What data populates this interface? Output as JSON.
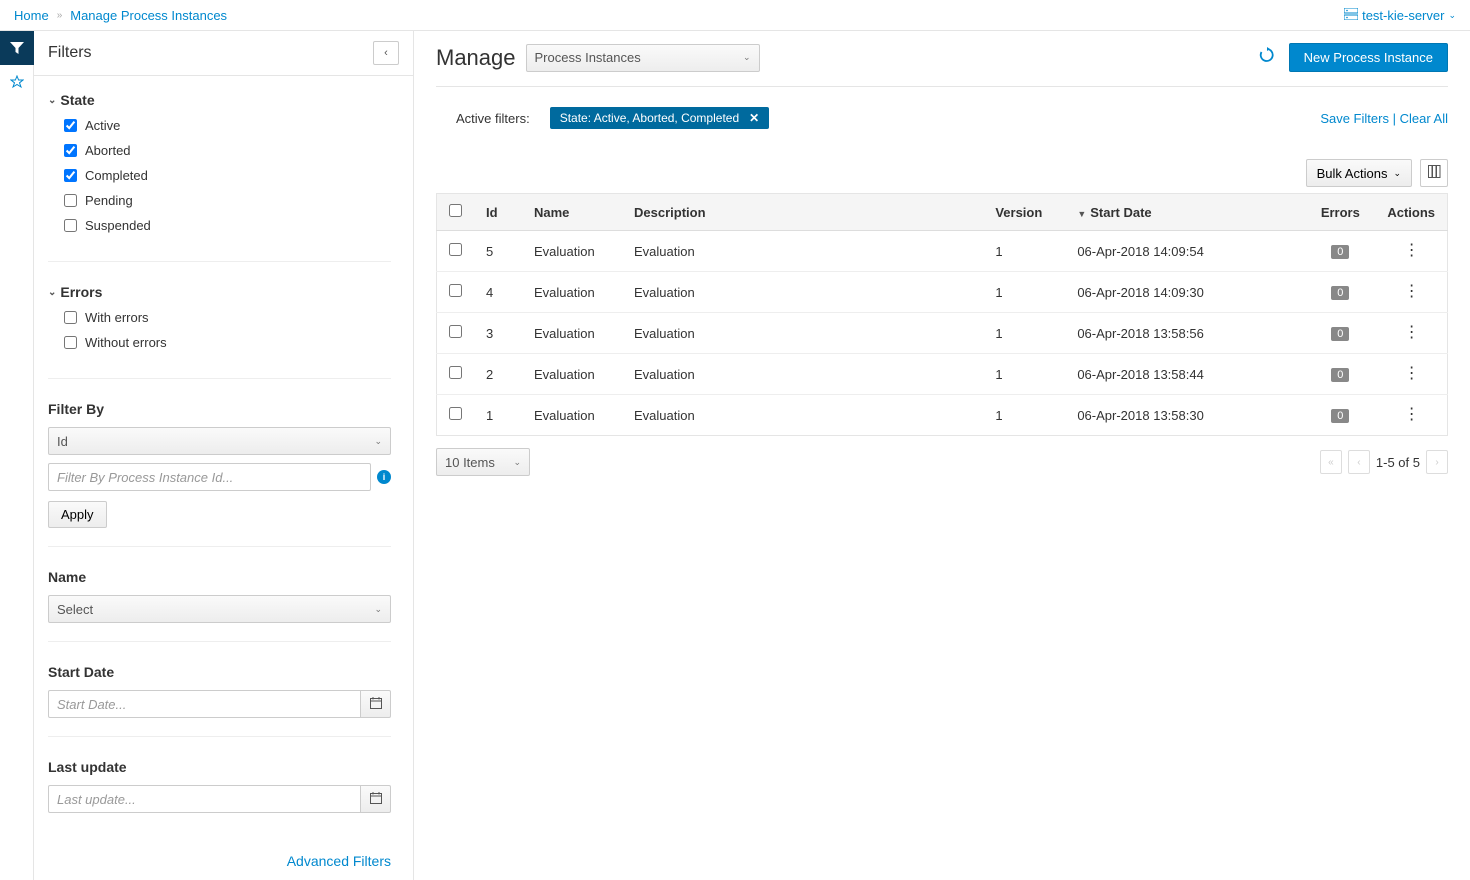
{
  "breadcrumb": {
    "home": "Home",
    "current": "Manage Process Instances"
  },
  "server": {
    "name": "test-kie-server"
  },
  "filtersPanel": {
    "title": "Filters",
    "state": {
      "label": "State",
      "options": [
        {
          "label": "Active",
          "checked": true
        },
        {
          "label": "Aborted",
          "checked": true
        },
        {
          "label": "Completed",
          "checked": true
        },
        {
          "label": "Pending",
          "checked": false
        },
        {
          "label": "Suspended",
          "checked": false
        }
      ]
    },
    "errors": {
      "label": "Errors",
      "options": [
        {
          "label": "With errors",
          "checked": false
        },
        {
          "label": "Without errors",
          "checked": false
        }
      ]
    },
    "filterBy": {
      "label": "Filter By",
      "selected": "Id",
      "placeholder": "Filter By Process Instance Id...",
      "apply": "Apply"
    },
    "name": {
      "label": "Name",
      "selected": "Select"
    },
    "startDate": {
      "label": "Start Date",
      "placeholder": "Start Date..."
    },
    "lastUpdate": {
      "label": "Last update",
      "placeholder": "Last update..."
    },
    "advanced": "Advanced Filters"
  },
  "content": {
    "heading": "Manage",
    "managingSelect": "Process Instances",
    "newBtn": "New Process Instance",
    "activeFiltersLabel": "Active filters:",
    "activeFilterChip": "State: Active, Aborted, Completed",
    "saveFilters": "Save Filters",
    "clearAll": "Clear All",
    "bulkActions": "Bulk Actions",
    "columns": [
      "Id",
      "Name",
      "Description",
      "Version",
      "Start Date",
      "Errors",
      "Actions"
    ],
    "rows": [
      {
        "id": "5",
        "name": "Evaluation",
        "desc": "Evaluation",
        "version": "1",
        "start": "06-Apr-2018 14:09:54",
        "errors": "0"
      },
      {
        "id": "4",
        "name": "Evaluation",
        "desc": "Evaluation",
        "version": "1",
        "start": "06-Apr-2018 14:09:30",
        "errors": "0"
      },
      {
        "id": "3",
        "name": "Evaluation",
        "desc": "Evaluation",
        "version": "1",
        "start": "06-Apr-2018 13:58:56",
        "errors": "0"
      },
      {
        "id": "2",
        "name": "Evaluation",
        "desc": "Evaluation",
        "version": "1",
        "start": "06-Apr-2018 13:58:44",
        "errors": "0"
      },
      {
        "id": "1",
        "name": "Evaluation",
        "desc": "Evaluation",
        "version": "1",
        "start": "06-Apr-2018 13:58:30",
        "errors": "0"
      }
    ],
    "itemsPerPage": "10 Items",
    "pageInfo": "1-5 of 5"
  }
}
